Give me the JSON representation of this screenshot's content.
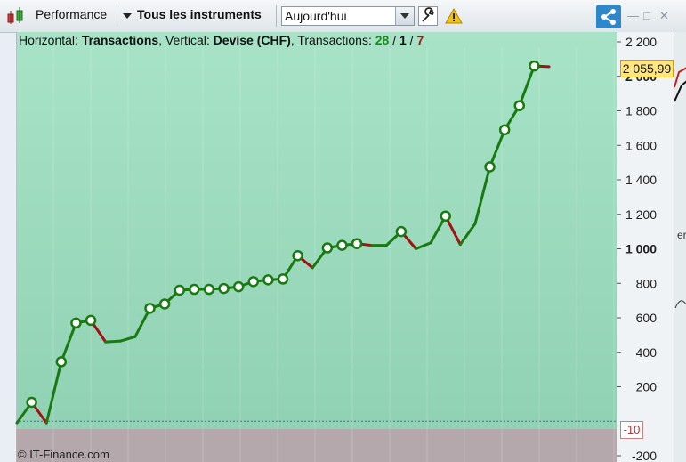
{
  "toolbar": {
    "performance_label": "Performance",
    "instruments_label": "Tous les instruments",
    "period_value": "Aujourd'hui"
  },
  "header": {
    "horizontal_label": "Horizontal:",
    "horizontal_value": "Transactions",
    "vertical_label": ", Vertical:",
    "vertical_value": "Devise (CHF)",
    "transactions_label": ", Transactions:",
    "win_count": "28",
    "sep1": " / ",
    "even_count": "1",
    "sep2": " / ",
    "loss_count": "7"
  },
  "price_label": "2 055,99",
  "min_label": "-10",
  "copyright": "© IT-Finance.com",
  "colors": {
    "up": "#1a7a12",
    "down": "#a31212",
    "marker": "#1a7a12"
  },
  "chart_data": {
    "type": "line",
    "title": "",
    "xlabel": "Transactions",
    "ylabel": "Devise (CHF)",
    "ylim": [
      -200,
      2300
    ],
    "y_ticks": [
      "2 200",
      "2 000",
      "1 800",
      "1 600",
      "1 400",
      "1 200",
      "1 000",
      "800",
      "600",
      "400",
      "200",
      "-200"
    ],
    "x": [
      0,
      1,
      2,
      3,
      4,
      5,
      6,
      7,
      8,
      9,
      10,
      11,
      12,
      13,
      14,
      15,
      16,
      17,
      18,
      19,
      20,
      21,
      22,
      23,
      24,
      25,
      26,
      27,
      28,
      29,
      30,
      31,
      32,
      33,
      34,
      35,
      36
    ],
    "values": [
      -10,
      110,
      -10,
      345,
      570,
      585,
      460,
      465,
      490,
      655,
      680,
      760,
      765,
      765,
      770,
      780,
      810,
      820,
      825,
      960,
      890,
      1005,
      1020,
      1030,
      1020,
      1020,
      1100,
      1000,
      1035,
      1190,
      1025,
      1145,
      1475,
      1690,
      1830,
      2060,
      2055.99
    ],
    "markers": [
      1,
      3,
      4,
      5,
      9,
      10,
      11,
      12,
      13,
      14,
      15,
      16,
      17,
      18,
      19,
      21,
      22,
      23,
      26,
      29,
      32,
      33,
      34,
      35
    ]
  }
}
